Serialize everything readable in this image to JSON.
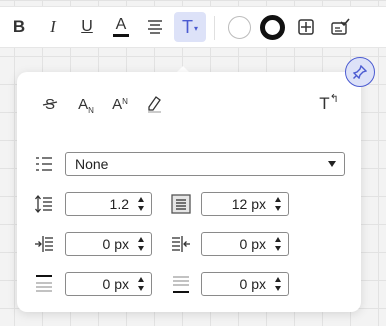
{
  "toolbar": {
    "bold": "B",
    "italic": "I",
    "underline": "U",
    "font_color": "A",
    "text_type": "T",
    "accent_color": "#4b5bd1"
  },
  "popover": {
    "subscript_label": "A",
    "subscript_suffix": "N",
    "superscript_label": "A",
    "superscript_suffix": "N",
    "transform_label": "T",
    "list_style": {
      "selected": "None"
    },
    "line_height": {
      "value": "1.2"
    },
    "paragraph_spacing": {
      "value": "12 px"
    },
    "indent_left": {
      "value": "0 px"
    },
    "indent_right": {
      "value": "0 px"
    },
    "space_before": {
      "value": "0 px"
    },
    "space_after": {
      "value": "0 px"
    }
  }
}
